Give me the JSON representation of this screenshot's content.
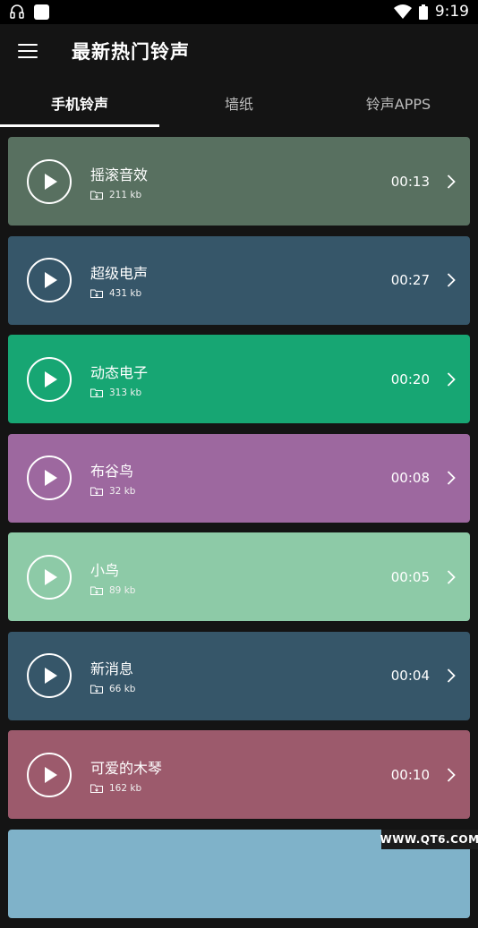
{
  "status_bar": {
    "time": "9:19"
  },
  "app_bar": {
    "title": "最新热门铃声"
  },
  "tabs": [
    {
      "label": "手机铃声",
      "active": true
    },
    {
      "label": "墙纸",
      "active": false
    },
    {
      "label": "铃声APPS",
      "active": false
    }
  ],
  "ringtones": [
    {
      "name": "摇滚音效",
      "size": "211 kb",
      "duration": "00:13",
      "color": "#587060"
    },
    {
      "name": "超级电声",
      "size": "431 kb",
      "duration": "00:27",
      "color": "#365669"
    },
    {
      "name": "动态电子",
      "size": "313 kb",
      "duration": "00:20",
      "color": "#17a673"
    },
    {
      "name": "布谷鸟",
      "size": "32 kb",
      "duration": "00:08",
      "color": "#9d689f"
    },
    {
      "name": "小鸟",
      "size": "89 kb",
      "duration": "00:05",
      "color": "#8dcaa7"
    },
    {
      "name": "新消息",
      "size": "66 kb",
      "duration": "00:04",
      "color": "#365669"
    },
    {
      "name": "可爱的木琴",
      "size": "162 kb",
      "duration": "00:10",
      "color": "#9c5a6c"
    },
    {
      "name": "",
      "size": "",
      "duration": "",
      "color": "#7fb2c9"
    }
  ],
  "watermark": "WWW.QT6.COM"
}
